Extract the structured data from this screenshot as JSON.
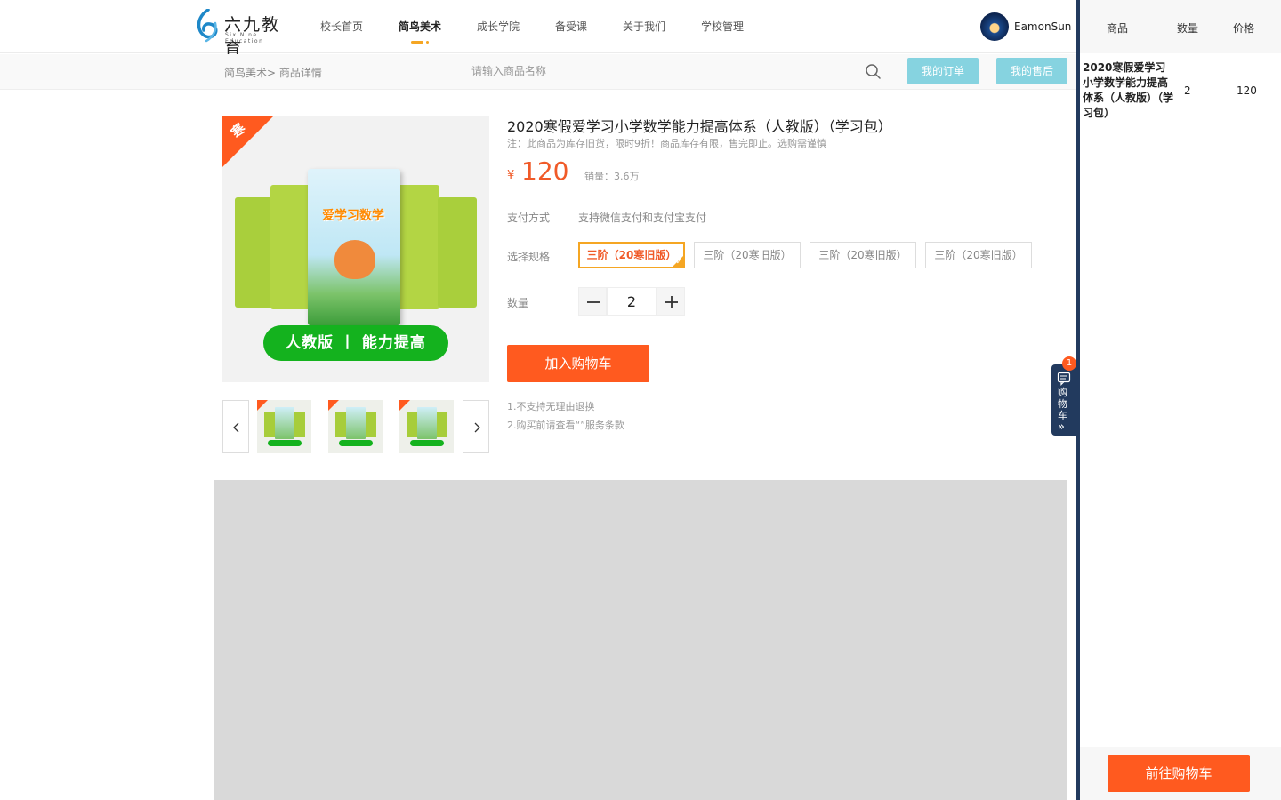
{
  "brand": {
    "name_cn": "六九教育",
    "name_en": "Six Nine Education",
    "color": "#1e88c8"
  },
  "nav": {
    "items": [
      {
        "label": "校长首页",
        "active": false
      },
      {
        "label": "简鸟美术",
        "active": true
      },
      {
        "label": "成长学院",
        "active": false
      },
      {
        "label": "备受课",
        "active": false
      },
      {
        "label": "关于我们",
        "active": false
      },
      {
        "label": "学校管理",
        "active": false
      }
    ],
    "accent": "#f5a623"
  },
  "user": {
    "name": "EamonSun"
  },
  "subbar": {
    "breadcrumb": "简鸟美术> 商品详情",
    "search_placeholder": "请输入商品名称",
    "my_orders": "我的订单",
    "my_aftersale": "我的售后"
  },
  "product": {
    "ribbon": "寒",
    "cover_title": "爱学习数学",
    "image_caption": "人教版 丨 能力提高",
    "title": "2020寒假爱学习小学数学能力提高体系（人教版）（学习包）",
    "note": "注：此商品为库存旧货，限时9折！商品库存有限，售完即止。选购需谨慎",
    "currency": "¥",
    "price": "120",
    "sales": "销量：3.6万",
    "pay_label": "支付方式",
    "pay_value": "支持微信支付和支付宝支付",
    "spec_label": "选择规格",
    "specs": [
      {
        "label": "三阶（20寒旧版）",
        "selected": true
      },
      {
        "label": "三阶（20寒旧版）",
        "selected": false
      },
      {
        "label": "三阶（20寒旧版）",
        "selected": false
      },
      {
        "label": "三阶（20寒旧版）",
        "selected": false
      }
    ],
    "qty_label": "数量",
    "qty": "2",
    "add_to_cart": "加入购物车",
    "policy": [
      "1.不支持无理由退换",
      "2.购买前请查看“”服务条款"
    ],
    "accent": "#ff5a1f"
  },
  "cart_tab": {
    "badge": "1",
    "label": "购物车",
    "arrows": "»"
  },
  "drawer": {
    "headers": {
      "product": "商品",
      "qty": "数量",
      "price": "价格"
    },
    "rows": [
      {
        "name": "2020寒假爱学习小学数学能力提高体系（人教版）（学习包）",
        "qty": "2",
        "price": "120"
      }
    ],
    "go_cart": "前往购物车"
  }
}
